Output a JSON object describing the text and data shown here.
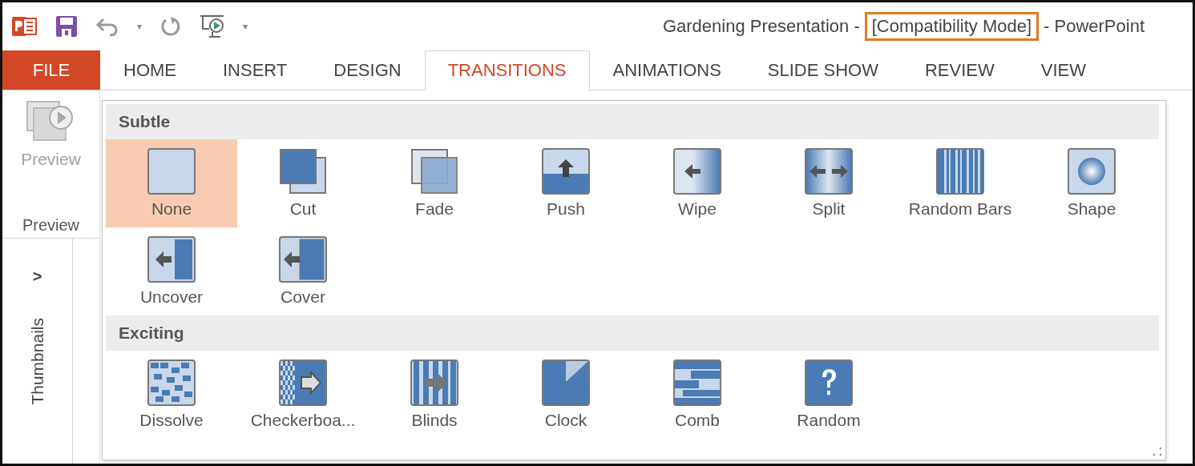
{
  "quick_access": {
    "undo_caret": "▾",
    "customize": "▾"
  },
  "window": {
    "document": "Gardening Presentation -",
    "mode": "[Compatibility Mode]",
    "app": "- PowerPoint"
  },
  "tabs": [
    {
      "label": "FILE",
      "kind": "file",
      "selected": false
    },
    {
      "label": "HOME",
      "kind": "tab",
      "selected": false
    },
    {
      "label": "INSERT",
      "kind": "tab",
      "selected": false
    },
    {
      "label": "DESIGN",
      "kind": "tab",
      "selected": false
    },
    {
      "label": "TRANSITIONS",
      "kind": "tab",
      "selected": true
    },
    {
      "label": "ANIMATIONS",
      "kind": "tab",
      "selected": false
    },
    {
      "label": "SLIDE SHOW",
      "kind": "tab",
      "selected": false
    },
    {
      "label": "REVIEW",
      "kind": "tab",
      "selected": false
    },
    {
      "label": "VIEW",
      "kind": "tab",
      "selected": false
    }
  ],
  "ribbon": {
    "preview_button": "Preview",
    "group_label": "Preview",
    "disabled": true
  },
  "thumbnails_pane": {
    "expand": ">",
    "label": "Thumbnails"
  },
  "gallery": {
    "sections": [
      {
        "title": "Subtle",
        "items": [
          {
            "label": "None",
            "kind": "none",
            "selected": true
          },
          {
            "label": "Cut",
            "kind": "cut",
            "selected": false
          },
          {
            "label": "Fade",
            "kind": "fade",
            "selected": false
          },
          {
            "label": "Push",
            "kind": "push",
            "selected": false
          },
          {
            "label": "Wipe",
            "kind": "wipe",
            "selected": false
          },
          {
            "label": "Split",
            "kind": "split",
            "selected": false
          },
          {
            "label": "Random Bars",
            "kind": "bars",
            "selected": false
          },
          {
            "label": "Shape",
            "kind": "shape",
            "selected": false
          },
          {
            "label": "Uncover",
            "kind": "uncover",
            "selected": false
          },
          {
            "label": "Cover",
            "kind": "cover",
            "selected": false
          }
        ]
      },
      {
        "title": "Exciting",
        "items": [
          {
            "label": "Dissolve",
            "kind": "dissolve",
            "selected": false
          },
          {
            "label": "Checkerboa...",
            "kind": "checker",
            "selected": false
          },
          {
            "label": "Blinds",
            "kind": "blinds",
            "selected": false
          },
          {
            "label": "Clock",
            "kind": "clock",
            "selected": false
          },
          {
            "label": "Comb",
            "kind": "comb",
            "selected": false
          },
          {
            "label": "Random",
            "kind": "random",
            "selected": false
          }
        ]
      }
    ]
  }
}
